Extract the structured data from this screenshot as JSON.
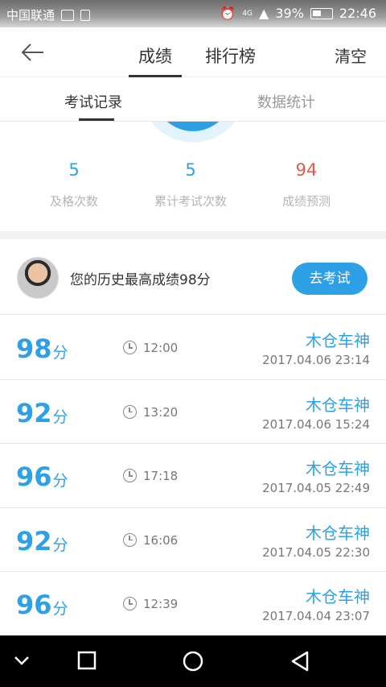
{
  "status_bar": {
    "carrier": "中国联通",
    "battery": "39%",
    "time": "22:46",
    "network": "4G"
  },
  "header": {
    "tabs": [
      "成绩",
      "排行榜"
    ],
    "active_tab": "成绩",
    "clear_label": "清空"
  },
  "subtabs": {
    "items": [
      "考试记录",
      "数据统计"
    ],
    "active": "考试记录"
  },
  "stats": [
    {
      "value": "5",
      "label": "及格次数",
      "color": "#2ea0e6"
    },
    {
      "value": "5",
      "label": "累计考试次数",
      "color": "#2ea0e6"
    },
    {
      "value": "94",
      "label": "成绩预测",
      "color": "#e05a4a"
    }
  ],
  "best": {
    "text": "您的历史最高成绩98分",
    "button": "去考试"
  },
  "records": [
    {
      "score": "98",
      "unit": "分",
      "duration": "12:00",
      "name": "木仓车神",
      "date": "2017.04.06  23:14"
    },
    {
      "score": "92",
      "unit": "分",
      "duration": "13:20",
      "name": "木仓车神",
      "date": "2017.04.06  15:24"
    },
    {
      "score": "96",
      "unit": "分",
      "duration": "17:18",
      "name": "木仓车神",
      "date": "2017.04.05  22:49"
    },
    {
      "score": "92",
      "unit": "分",
      "duration": "16:06",
      "name": "木仓车神",
      "date": "2017.04.05  22:30"
    },
    {
      "score": "96",
      "unit": "分",
      "duration": "12:39",
      "name": "木仓车神",
      "date": "2017.04.04  23:07"
    }
  ],
  "colors": {
    "accent": "#2ea0e6",
    "prediction": "#e05a4a"
  }
}
